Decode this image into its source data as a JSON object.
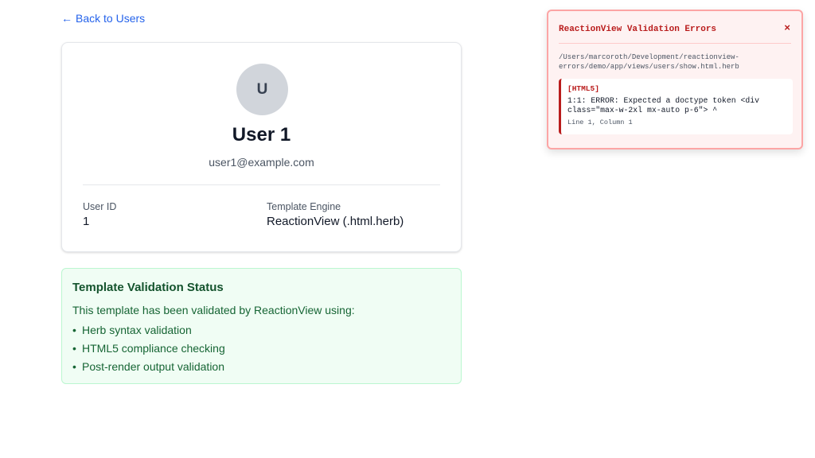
{
  "nav": {
    "back_arrow": "←",
    "back_label": "Back to Users"
  },
  "user": {
    "avatar_initial": "U",
    "name": "User 1",
    "email": "user1@example.com",
    "fields": [
      {
        "label": "User ID",
        "value": "1"
      },
      {
        "label": "Template Engine",
        "value": "ReactionView (.html.herb)"
      }
    ]
  },
  "validation_status": {
    "title": "Template Validation Status",
    "intro": "This template has been validated by ReactionView using:",
    "items": [
      "Herb syntax validation",
      "HTML5 compliance checking",
      "Post-render output validation"
    ]
  },
  "error_panel": {
    "title": "ReactionView Validation Errors",
    "close_glyph": "×",
    "file_path": "/Users/marcoroth/Development/reactionview-errors/demo/app/views/users/show.html.herb",
    "errors": [
      {
        "tag": "[HTML5]",
        "message": "1:1: ERROR: Expected a doctype token <div class=\"max-w-2xl mx-auto p-6\"> ^",
        "location": "Line 1, Column 1"
      }
    ]
  },
  "colors": {
    "link": "#2563eb",
    "success_bg": "#f0fdf4",
    "success_border": "#bbf7d0",
    "error_bg": "#fef2f2",
    "error_accent": "#b91c1c"
  },
  "icons": {
    "back": "arrow-left-icon",
    "close": "close-icon",
    "bullet": "bullet-icon"
  }
}
